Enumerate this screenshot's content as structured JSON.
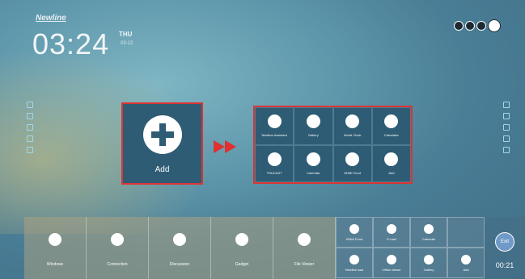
{
  "brand": "Newline",
  "clock": {
    "time": "03:24",
    "day": "THU",
    "date": "03-12"
  },
  "add_tile": {
    "label": "Add"
  },
  "apps": [
    {
      "label": "Newline Assistant",
      "icon": "assistant-icon"
    },
    {
      "label": "Gallery",
      "icon": "gallery-icon"
    },
    {
      "label": "World Clock",
      "icon": "world-clock-icon"
    },
    {
      "label": "Calculator",
      "icon": "calculator-icon"
    },
    {
      "label": "TRUCAST",
      "icon": "trucast-icon"
    },
    {
      "label": "Calendar",
      "icon": "calendar-icon"
    },
    {
      "label": "HDMI Front",
      "icon": "hdmi-icon"
    },
    {
      "label": "Add",
      "icon": "add-icon"
    }
  ],
  "dock": [
    {
      "label": "Windows",
      "icon": "windows-icon"
    },
    {
      "label": "Connection",
      "icon": "connection-icon"
    },
    {
      "label": "Discussion",
      "icon": "discussion-icon"
    },
    {
      "label": "Gadget",
      "icon": "gadget-icon"
    },
    {
      "label": "File Viewer",
      "icon": "file-viewer-icon"
    }
  ],
  "mini": [
    {
      "label": "HDMI Front",
      "icon": "hdmi-icon"
    },
    {
      "label": "E-mail",
      "icon": "email-icon"
    },
    {
      "label": "Calendar",
      "icon": "calendar-icon"
    },
    {
      "label": "",
      "icon": ""
    },
    {
      "label": "Newline assi",
      "icon": "assistant-icon"
    },
    {
      "label": "Office viewer",
      "icon": "office-viewer-icon"
    },
    {
      "label": "Gallery",
      "icon": "gallery-icon"
    },
    {
      "label": "Add",
      "icon": "add-icon"
    }
  ],
  "exit": {
    "label": "Exit",
    "timer": "00:21"
  },
  "colors": {
    "highlight": "#dd3333",
    "tile": "#2e5c74"
  }
}
